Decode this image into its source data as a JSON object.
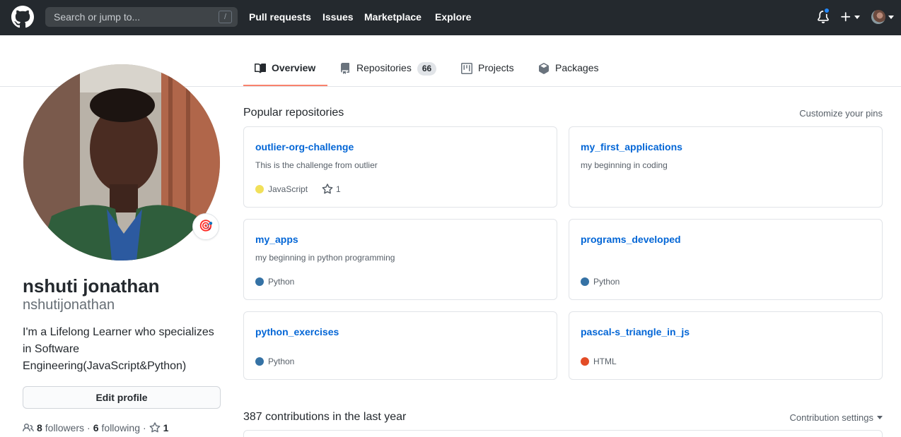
{
  "header": {
    "search_placeholder": "Search or jump to...",
    "search_shortcut": "/",
    "nav": [
      {
        "label": "Pull requests"
      },
      {
        "label": "Issues"
      },
      {
        "label": "Marketplace"
      },
      {
        "label": "Explore"
      }
    ],
    "icons": [
      "github-logo-icon",
      "bell-icon",
      "plus-icon",
      "caret-down-icon"
    ]
  },
  "tabs": [
    {
      "label": "Overview",
      "icon": "book-icon",
      "active": true
    },
    {
      "label": "Repositories",
      "icon": "repo-icon",
      "count": "66"
    },
    {
      "label": "Projects",
      "icon": "project-icon"
    },
    {
      "label": "Packages",
      "icon": "package-icon"
    }
  ],
  "profile": {
    "full_name": "nshuti jonathan",
    "username": "nshutijonathan",
    "bio": "I'm a Lifelong Learner who specializes in Software Engineering(JavaScript&Python)",
    "edit_label": "Edit profile",
    "status_emoji": "🎯",
    "followers_count": "8",
    "followers_label": "followers",
    "separator": "·",
    "following_count": "6",
    "following_label": "following",
    "star_separator": "·",
    "stars_count": "1"
  },
  "popular": {
    "title": "Popular repositories",
    "customize_label": "Customize your pins",
    "repos": [
      {
        "name": "outlier-org-challenge",
        "description": "This is the challenge from outlier",
        "language": "JavaScript",
        "language_color": "#f1e05a",
        "stars": "1"
      },
      {
        "name": "my_first_applications",
        "description": "my beginning in coding",
        "language": "",
        "language_color": ""
      },
      {
        "name": "my_apps",
        "description": "my beginning in python programming",
        "language": "Python",
        "language_color": "#3572a5"
      },
      {
        "name": "programs_developed",
        "description": "",
        "language": "Python",
        "language_color": "#3572a5"
      },
      {
        "name": "python_exercises",
        "description": "",
        "language": "Python",
        "language_color": "#3572a5"
      },
      {
        "name": "pascal-s_triangle_in_js",
        "description": "",
        "language": "HTML",
        "language_color": "#e34c26"
      }
    ]
  },
  "contributions": {
    "title": "387 contributions in the last year",
    "settings_label": "Contribution settings"
  },
  "colors": {
    "header_bg": "#24292e",
    "link_blue": "#0366d6",
    "active_tab_underline": "#f9826c",
    "notification_dot": "#2188ff"
  }
}
